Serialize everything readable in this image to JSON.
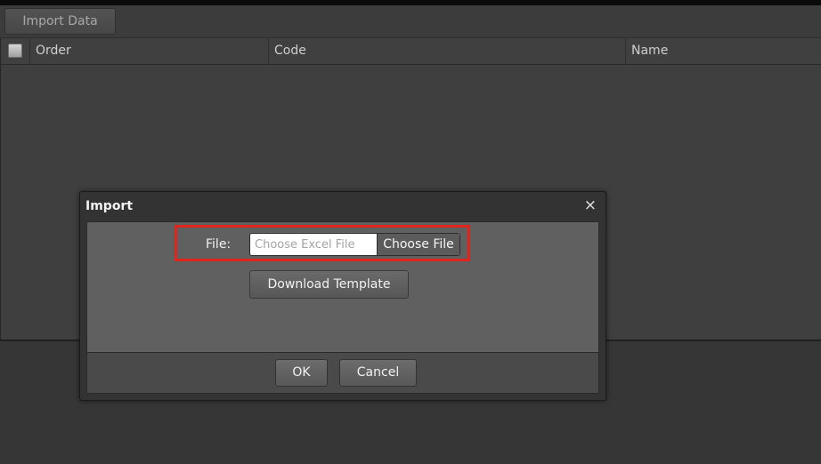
{
  "toolbar": {
    "import_data_label": "Import Data"
  },
  "grid": {
    "columns": [
      "Order",
      "Code",
      "Name"
    ],
    "select_all_checked": false,
    "rows": []
  },
  "dialog": {
    "title": "Import",
    "close_glyph": "×",
    "close_icon": "close-icon",
    "file_label": "File:",
    "file_placeholder": "Choose Excel File",
    "choose_file_label": "Choose File",
    "download_template_label": "Download Template",
    "ok_label": "OK",
    "cancel_label": "Cancel"
  },
  "colors": {
    "highlight": "#e0251d",
    "background": "#3a3a3a",
    "dialog_body": "#606060"
  }
}
